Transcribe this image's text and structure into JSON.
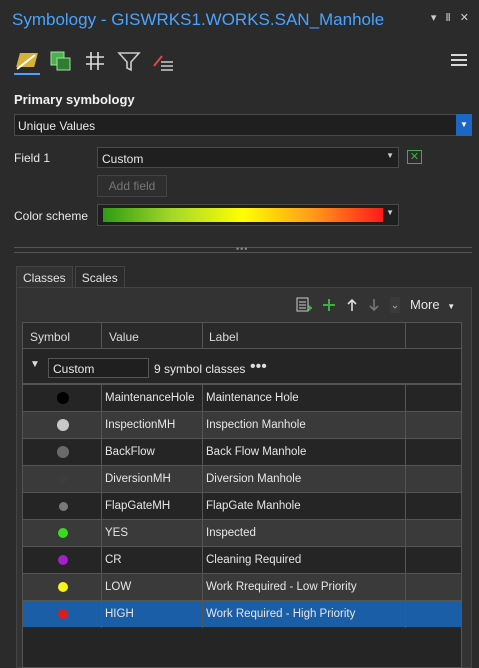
{
  "window": {
    "title": "Symbology - GISWRKS1.WORKS.SAN_Manhole",
    "controls": [
      "▾",
      "Ⅱ",
      "✕"
    ]
  },
  "toolbar": {
    "tools": [
      {
        "name": "primary-symbology-icon",
        "active": true
      },
      {
        "name": "vary-symbology-icon",
        "active": false
      },
      {
        "name": "symbol-layers-icon",
        "active": false
      },
      {
        "name": "filter-icon",
        "active": false
      },
      {
        "name": "label-display-icon",
        "active": false
      }
    ]
  },
  "primary": {
    "heading": "Primary symbology",
    "renderer": "Unique Values",
    "field1_label": "Field 1",
    "field1_value": "Custom",
    "add_field": "Add field",
    "color_scheme_label": "Color scheme"
  },
  "tabs": [
    "Classes",
    "Scales"
  ],
  "classes_toolbar": {
    "more": "More"
  },
  "grid": {
    "headers": [
      "Symbol",
      "Value",
      "Label"
    ],
    "group": {
      "name": "Custom",
      "count_text": "9 symbol classes",
      "menu": "•••"
    },
    "rows": [
      {
        "value": "MaintenanceHole",
        "label": "Maintenance Hole",
        "color": "#000000",
        "size": 12
      },
      {
        "value": "InspectionMH",
        "label": "Inspection Manhole",
        "color": "#c8c8c8",
        "size": 12
      },
      {
        "value": "BackFlow",
        "label": "Back Flow Manhole",
        "color": "#6a6a6a",
        "size": 12
      },
      {
        "value": "DiversionMH",
        "label": "Diversion Manhole",
        "color": "#3c3c3c",
        "size": 10
      },
      {
        "value": "FlapGateMH",
        "label": "FlapGate Manhole",
        "color": "#7a7a7a",
        "size": 9
      },
      {
        "value": "YES",
        "label": "Inspected",
        "color": "#3adb1f",
        "size": 10
      },
      {
        "value": "CR",
        "label": "Cleaning Required",
        "color": "#a21fc9",
        "size": 10
      },
      {
        "value": "LOW",
        "label": "Work Rrequired - Low Priority",
        "color": "#f5f51a",
        "size": 10
      },
      {
        "value": "HIGH",
        "label": "Work Required - High Priority",
        "color": "#e01a1a",
        "size": 10
      }
    ],
    "selected_index": 8
  },
  "colors": {
    "accent": "#4aa3ff",
    "selection": "#1a5ea8",
    "add_green": "#3cb043"
  }
}
